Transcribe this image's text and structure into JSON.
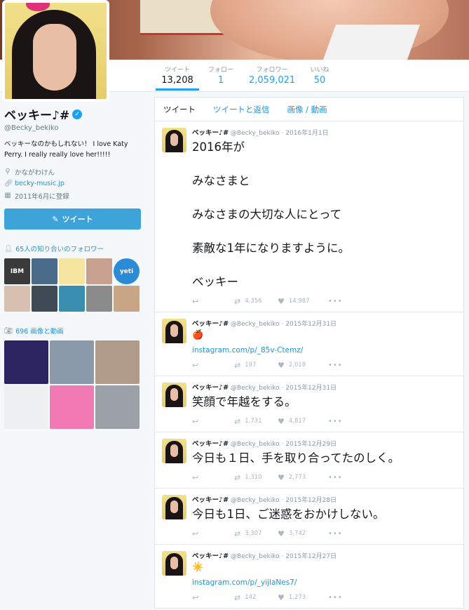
{
  "profile": {
    "name": "ベッキー♪#",
    "handle": "@Becky_bekiko",
    "bio": "ベッキーなのかもしれない！ I love Katy Perry. I really really love her!!!!!",
    "location": "かながわけん",
    "url": "becky-music.jp",
    "joined": "2011年6月に登録",
    "tweet_button": "ツイート"
  },
  "stats": [
    {
      "label": "ツイート",
      "value": "13,208"
    },
    {
      "label": "フォロー",
      "value": "1"
    },
    {
      "label": "フォロワー",
      "value": "2,059,021"
    },
    {
      "label": "いいね",
      "value": "50"
    }
  ],
  "followers_section": {
    "label": "65人の知り合いのフォロワー"
  },
  "media_section": {
    "label": "696 画像と動画"
  },
  "follower_tiles": [
    {
      "label": "IBM",
      "color": "#3a3a3a"
    },
    {
      "label": "",
      "color": "#4a6a8a"
    },
    {
      "label": "",
      "color": "#f4e6a0"
    },
    {
      "label": "",
      "color": "#c8a090"
    },
    {
      "label": "yeti",
      "color": "#2b8bd6"
    },
    {
      "label": "",
      "color": "#d7c0b0"
    },
    {
      "label": "",
      "color": "#3f4a55"
    },
    {
      "label": "",
      "color": "#3a8fb0"
    },
    {
      "label": "",
      "color": "#8b8b8b"
    },
    {
      "label": "",
      "color": "#c7a585"
    }
  ],
  "media_tiles": [
    {
      "color": "#2a2560"
    },
    {
      "color": "#8a9aa8"
    },
    {
      "color": "#b09a8a"
    },
    {
      "color": "#eef0f2"
    },
    {
      "color": "#f27ab4"
    },
    {
      "color": "#9aa0a6"
    }
  ],
  "timeline": {
    "tabs": [
      "ツイート",
      "ツイートと返信",
      "画像 / 動画"
    ],
    "tweets": [
      {
        "name": "ベッキー♪#",
        "handle": "@Becky_bekiko",
        "date": "2016年1月1日",
        "lines": [
          "2016年が",
          "みなさまと",
          "みなさまの大切な人にとって",
          "素敵な1年になりますように。",
          "ベッキー"
        ],
        "retweets": "4,356",
        "likes": "14,987"
      },
      {
        "name": "ベッキー♪#",
        "handle": "@Becky_bekiko",
        "date": "2015年12月31日",
        "emoji": "🍎",
        "link": "instagram.com/p/_85v-Ctemz/",
        "retweets": "197",
        "likes": "2,018"
      },
      {
        "name": "ベッキー♪#",
        "handle": "@Becky_bekiko",
        "date": "2015年12月31日",
        "lines": [
          "笑顔で年越をする。"
        ],
        "retweets": "1,731",
        "likes": "4,817"
      },
      {
        "name": "ベッキー♪#",
        "handle": "@Becky_bekiko",
        "date": "2015年12月29日",
        "lines": [
          "今日も１日、手を取り合ってたのしく。"
        ],
        "retweets": "1,310",
        "likes": "2,773"
      },
      {
        "name": "ベッキー♪#",
        "handle": "@Becky_bekiko",
        "date": "2015年12月28日",
        "lines": [
          "今日も1日、ご迷惑をおかけしない。"
        ],
        "retweets": "3,307",
        "likes": "3,742"
      },
      {
        "name": "ベッキー♪#",
        "handle": "@Becky_bekiko",
        "date": "2015年12月27日",
        "emoji": "☀️",
        "link": "instagram.com/p/_yijlaNes7/",
        "retweets": "142",
        "likes": "1,273"
      }
    ]
  },
  "icons": {
    "location": "map-pin-icon",
    "link": "link-icon",
    "calendar": "calendar-icon",
    "person": "person-icon",
    "camera": "camera-icon",
    "reply": "reply-icon",
    "retweet": "retweet-icon",
    "like": "heart-icon",
    "more": "more-icon",
    "verified": "verified-badge-icon"
  }
}
